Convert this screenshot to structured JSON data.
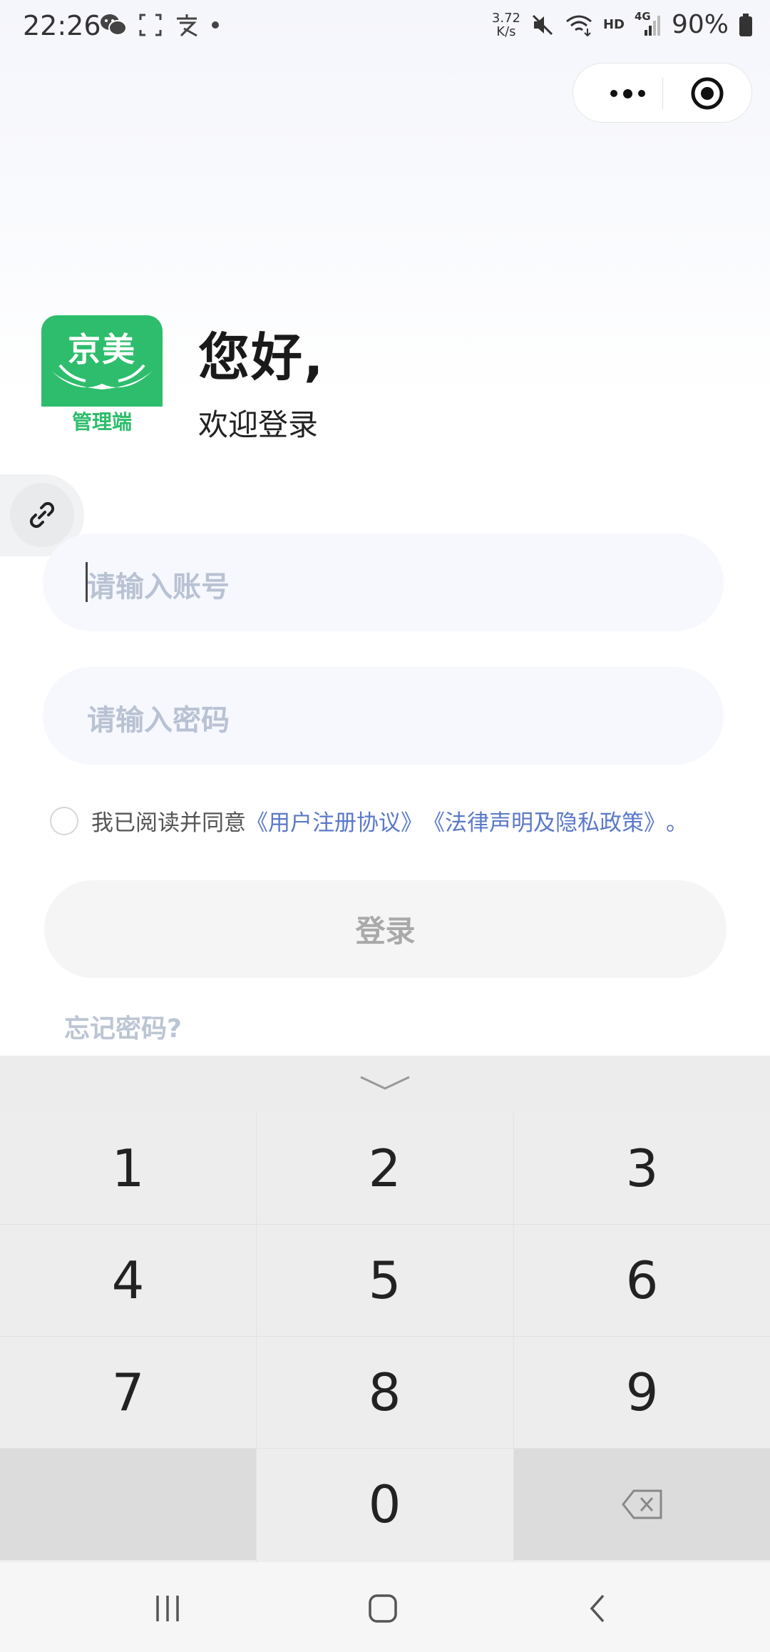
{
  "status_bar": {
    "time": "22:26",
    "speed_value": "3.72",
    "speed_unit": "K/s",
    "hd_label": "HD",
    "network_label": "4G",
    "battery": "90%"
  },
  "header": {
    "logo_title": "京美",
    "logo_subtitle": "管理端",
    "greeting": "您好,",
    "welcome": "欢迎登录"
  },
  "form": {
    "account_placeholder": "请输入账号",
    "password_placeholder": "请输入密码",
    "agree_prefix": "我已阅读并同意",
    "user_agreement": "《用户注册协议》",
    "privacy_policy": "《法律声明及隐私政策》",
    "agree_suffix": "。",
    "agreed": false,
    "login_label": "登录",
    "forgot_label": "忘记密码?"
  },
  "keypad": {
    "keys": [
      "1",
      "2",
      "3",
      "4",
      "5",
      "6",
      "7",
      "8",
      "9",
      "",
      "0",
      "backspace"
    ]
  },
  "colors": {
    "brand_green": "#2dbd6c",
    "link_blue": "#5b79c9"
  },
  "icons": {
    "link": "link-icon",
    "more": "more-dots-icon",
    "close": "target-close-icon",
    "backspace": "backspace-icon"
  }
}
